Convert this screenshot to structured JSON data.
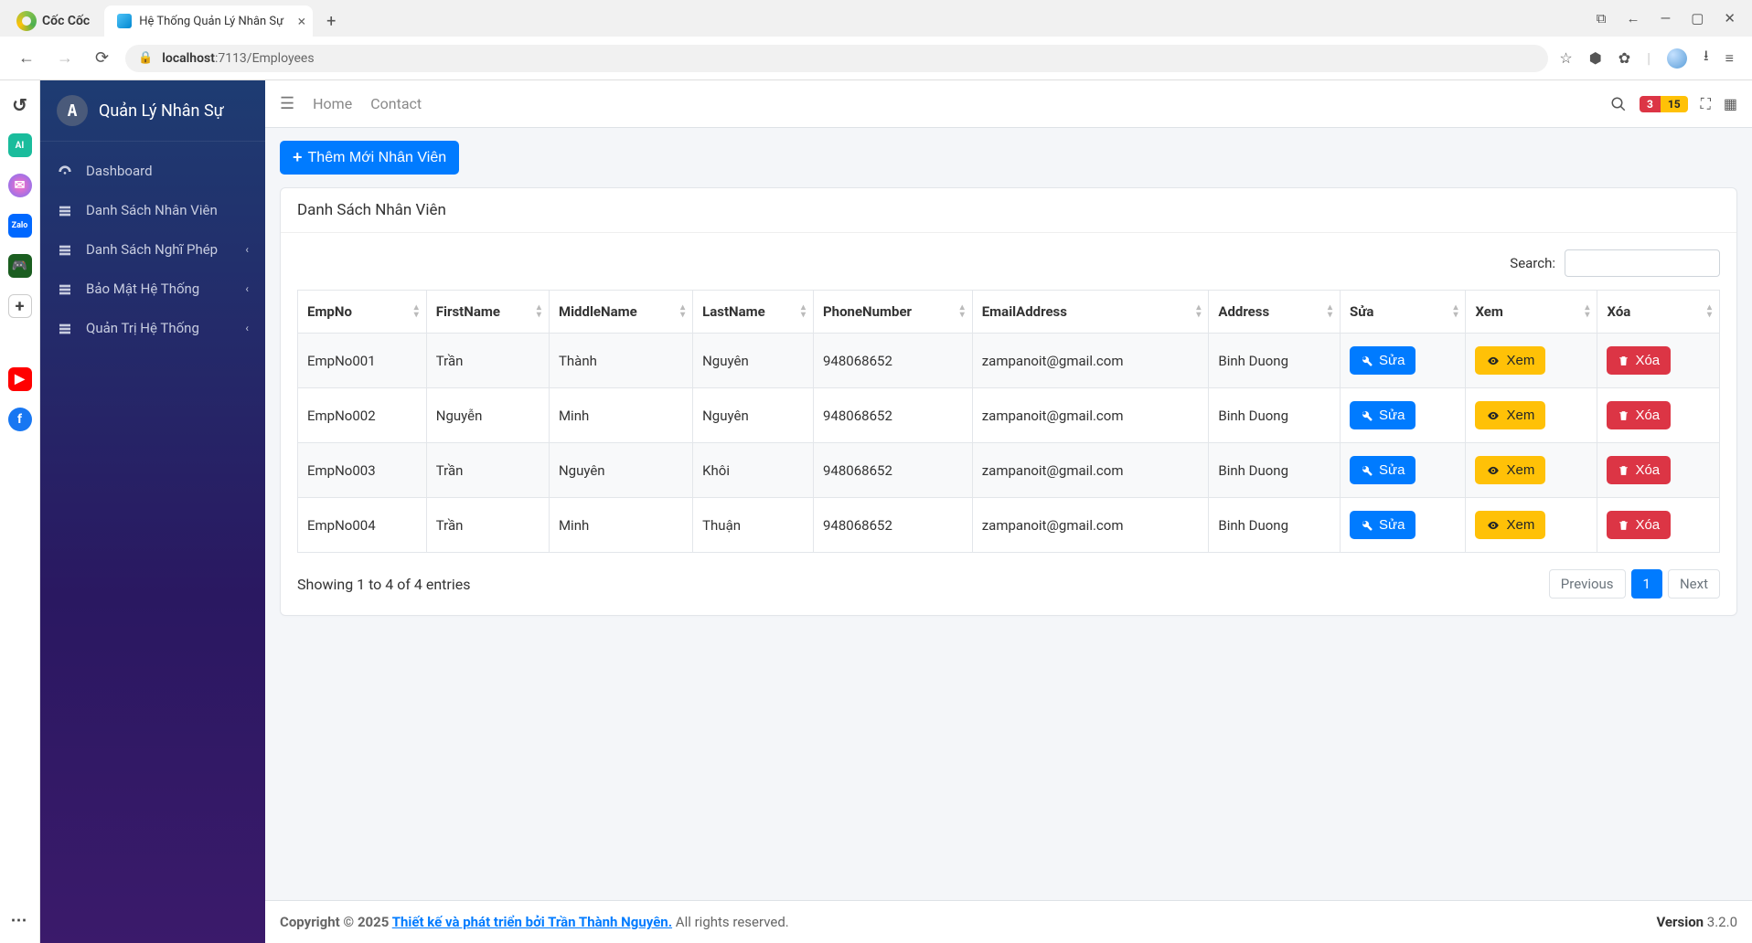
{
  "browser": {
    "name": "Cốc Cốc",
    "tab_title": "Hệ Thống Quản Lý Nhân Sự",
    "url_host": "localhost",
    "url_port_path": ":7113/Employees"
  },
  "sidebar": {
    "title": "Quản Lý Nhân Sự",
    "items": [
      "Dashboard",
      "Danh Sách Nhân Viên",
      "Danh Sách Nghĩ Phép",
      "Bảo Mật Hệ Thống",
      "Quản Trị Hệ Thống"
    ]
  },
  "topnav": {
    "home": "Home",
    "contact": "Contact"
  },
  "badges": {
    "red": "3",
    "yellow": "15"
  },
  "add_button": "Thêm Mới Nhân Viên",
  "card_title": "Danh Sách Nhân Viên",
  "search_label": "Search:",
  "columns": [
    "EmpNo",
    "FirstName",
    "MiddleName",
    "LastName",
    "PhoneNumber",
    "EmailAddress",
    "Address",
    "Sửa",
    "Xem",
    "Xóa"
  ],
  "actions": {
    "edit": "Sửa",
    "view": "Xem",
    "delete": "Xóa"
  },
  "rows": [
    {
      "empno": "EmpNo001",
      "first": "Trần",
      "middle": "Thành",
      "last": "Nguyên",
      "phone": "948068652",
      "email": "zampanoit@gmail.com",
      "address": "Binh Duong"
    },
    {
      "empno": "EmpNo002",
      "first": "Nguyễn",
      "middle": "Minh",
      "last": "Nguyên",
      "phone": "948068652",
      "email": "zampanoit@gmail.com",
      "address": "Binh Duong"
    },
    {
      "empno": "EmpNo003",
      "first": "Trần",
      "middle": "Nguyên",
      "last": "Khôi",
      "phone": "948068652",
      "email": "zampanoit@gmail.com",
      "address": "Binh Duong"
    },
    {
      "empno": "EmpNo004",
      "first": "Trần",
      "middle": "Minh",
      "last": "Thuận",
      "phone": "948068652",
      "email": "zampanoit@gmail.com",
      "address": "Binh Duong"
    }
  ],
  "info_text": "Showing 1 to 4 of 4 entries",
  "pager": {
    "prev": "Previous",
    "pages": [
      "1"
    ],
    "next": "Next"
  },
  "footer": {
    "copyright": "Copyright © 2025 ",
    "link": "Thiết kế và phát triển bởi Trần Thành Nguyên.",
    "rights": " All rights reserved.",
    "version_label": "Version",
    "version": " 3.2.0"
  }
}
